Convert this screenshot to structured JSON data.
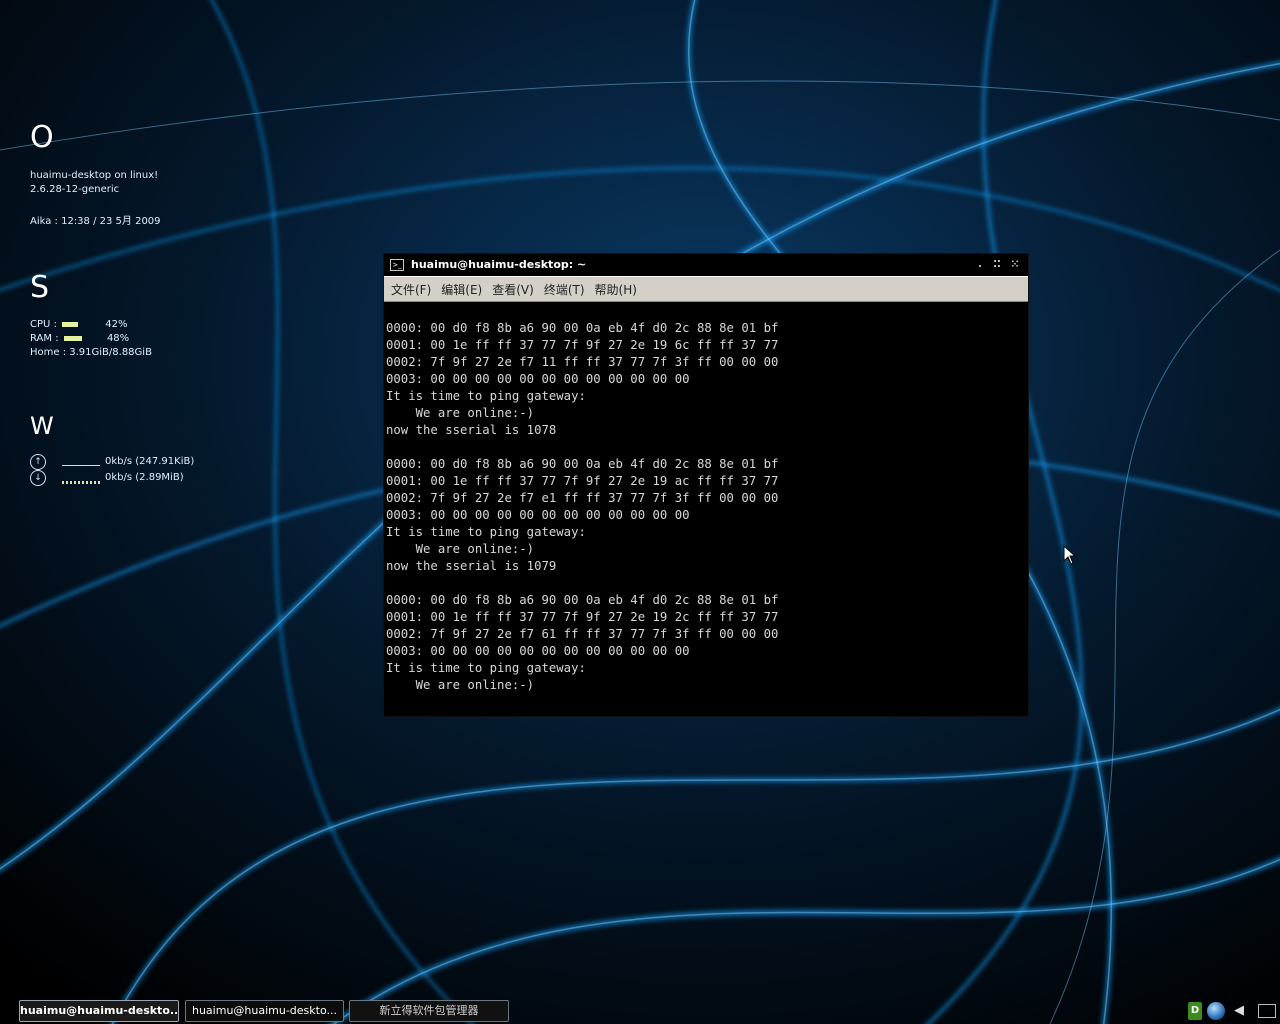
{
  "conky": {
    "section_o": "O",
    "host_line": "huaimu-desktop on linux!",
    "kernel": "2.6.28-12-generic",
    "clock": "Aika : 12:38 / 23  5月 2009",
    "section_s": "S",
    "cpu_label": "CPU :",
    "cpu_value": "42%",
    "cpu_percent": 42,
    "ram_label": "RAM :",
    "ram_value": "48%",
    "ram_percent": 48,
    "home_line": "Home : 3.91GiB/8.88GiB",
    "section_w": "W",
    "upload_line": "0kb/s (247.91KiB)",
    "download_line": "0kb/s (2.89MiB)"
  },
  "terminal": {
    "title": "huaimu@huaimu-desktop: ~",
    "menu": [
      "文件(F)",
      "编辑(E)",
      "查看(V)",
      "终端(T)",
      "帮助(H)"
    ],
    "lines": [
      "0000: 00 d0 f8 8b a6 90 00 0a eb 4f d0 2c 88 8e 01 bf",
      "0001: 00 1e ff ff 37 77 7f 9f 27 2e 19 6c ff ff 37 77",
      "0002: 7f 9f 27 2e f7 11 ff ff 37 77 7f 3f ff 00 00 00",
      "0003: 00 00 00 00 00 00 00 00 00 00 00 00",
      "It is time to ping gateway:",
      "    We are online:-)",
      "now the sserial is 1078",
      "",
      "0000: 00 d0 f8 8b a6 90 00 0a eb 4f d0 2c 88 8e 01 bf",
      "0001: 00 1e ff ff 37 77 7f 9f 27 2e 19 ac ff ff 37 77",
      "0002: 7f 9f 27 2e f7 e1 ff ff 37 77 7f 3f ff 00 00 00",
      "0003: 00 00 00 00 00 00 00 00 00 00 00 00",
      "It is time to ping gateway:",
      "    We are online:-)",
      "now the sserial is 1079",
      "",
      "0000: 00 d0 f8 8b a6 90 00 0a eb 4f d0 2c 88 8e 01 bf",
      "0001: 00 1e ff ff 37 77 7f 9f 27 2e 19 2c ff ff 37 77",
      "0002: 7f 9f 27 2e f7 61 ff ff 37 77 7f 3f ff 00 00 00",
      "0003: 00 00 00 00 00 00 00 00 00 00 00 00",
      "It is time to ping gateway:",
      "    We are online:-)"
    ]
  },
  "taskbar": {
    "tasks": [
      {
        "label": "huaimu@huaimu-deskto...",
        "active": true
      },
      {
        "label": "huaimu@huaimu-deskto...",
        "active": false
      },
      {
        "label": "新立得软件包管理器",
        "active": false
      }
    ],
    "tray_badge": "D"
  },
  "colors": {
    "terminal_text": "#d8d8d8",
    "menu_bg": "#d4d0c8",
    "wallpaper_glow": "#1aa3ff",
    "meter_fill": "#e7f1a4"
  }
}
